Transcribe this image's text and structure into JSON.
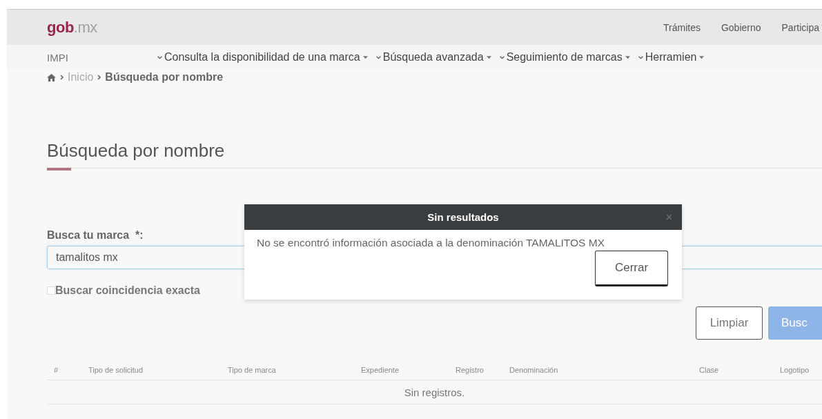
{
  "header": {
    "logo_main": "gob",
    "logo_suffix": ".mx",
    "links": [
      "Trámites",
      "Gobierno",
      "Participa"
    ]
  },
  "subnav": {
    "brand": "IMPI",
    "menus": [
      "Consulta la disponibilidad de una marca",
      "Búsqueda avanzada",
      "Seguimiento de marcas",
      "Herramien"
    ]
  },
  "breadcrumb": {
    "items": [
      "Inicio",
      "Búsqueda por nombre"
    ]
  },
  "title": "Búsqueda por nombre",
  "form": {
    "label": "Busca tu marca",
    "required_mark": "*:",
    "value": "tamalitos mx",
    "exact_match": {
      "label": "Buscar coincidencia exacta",
      "checked": false
    },
    "buttons": [
      "Limpiar",
      "Busc"
    ]
  },
  "table": {
    "columns": [
      "#",
      "Tipo de solicitud",
      "Tipo de marca",
      "Expediente",
      "Registro",
      "Denominación",
      "Clase",
      "Logotipo"
    ],
    "empty_message": "Sin registros."
  },
  "modal": {
    "title": "Sin resultados",
    "close": "×",
    "message": "No se encontró información asociada a la denominación TAMALITOS MX",
    "button": "Cerrar"
  }
}
